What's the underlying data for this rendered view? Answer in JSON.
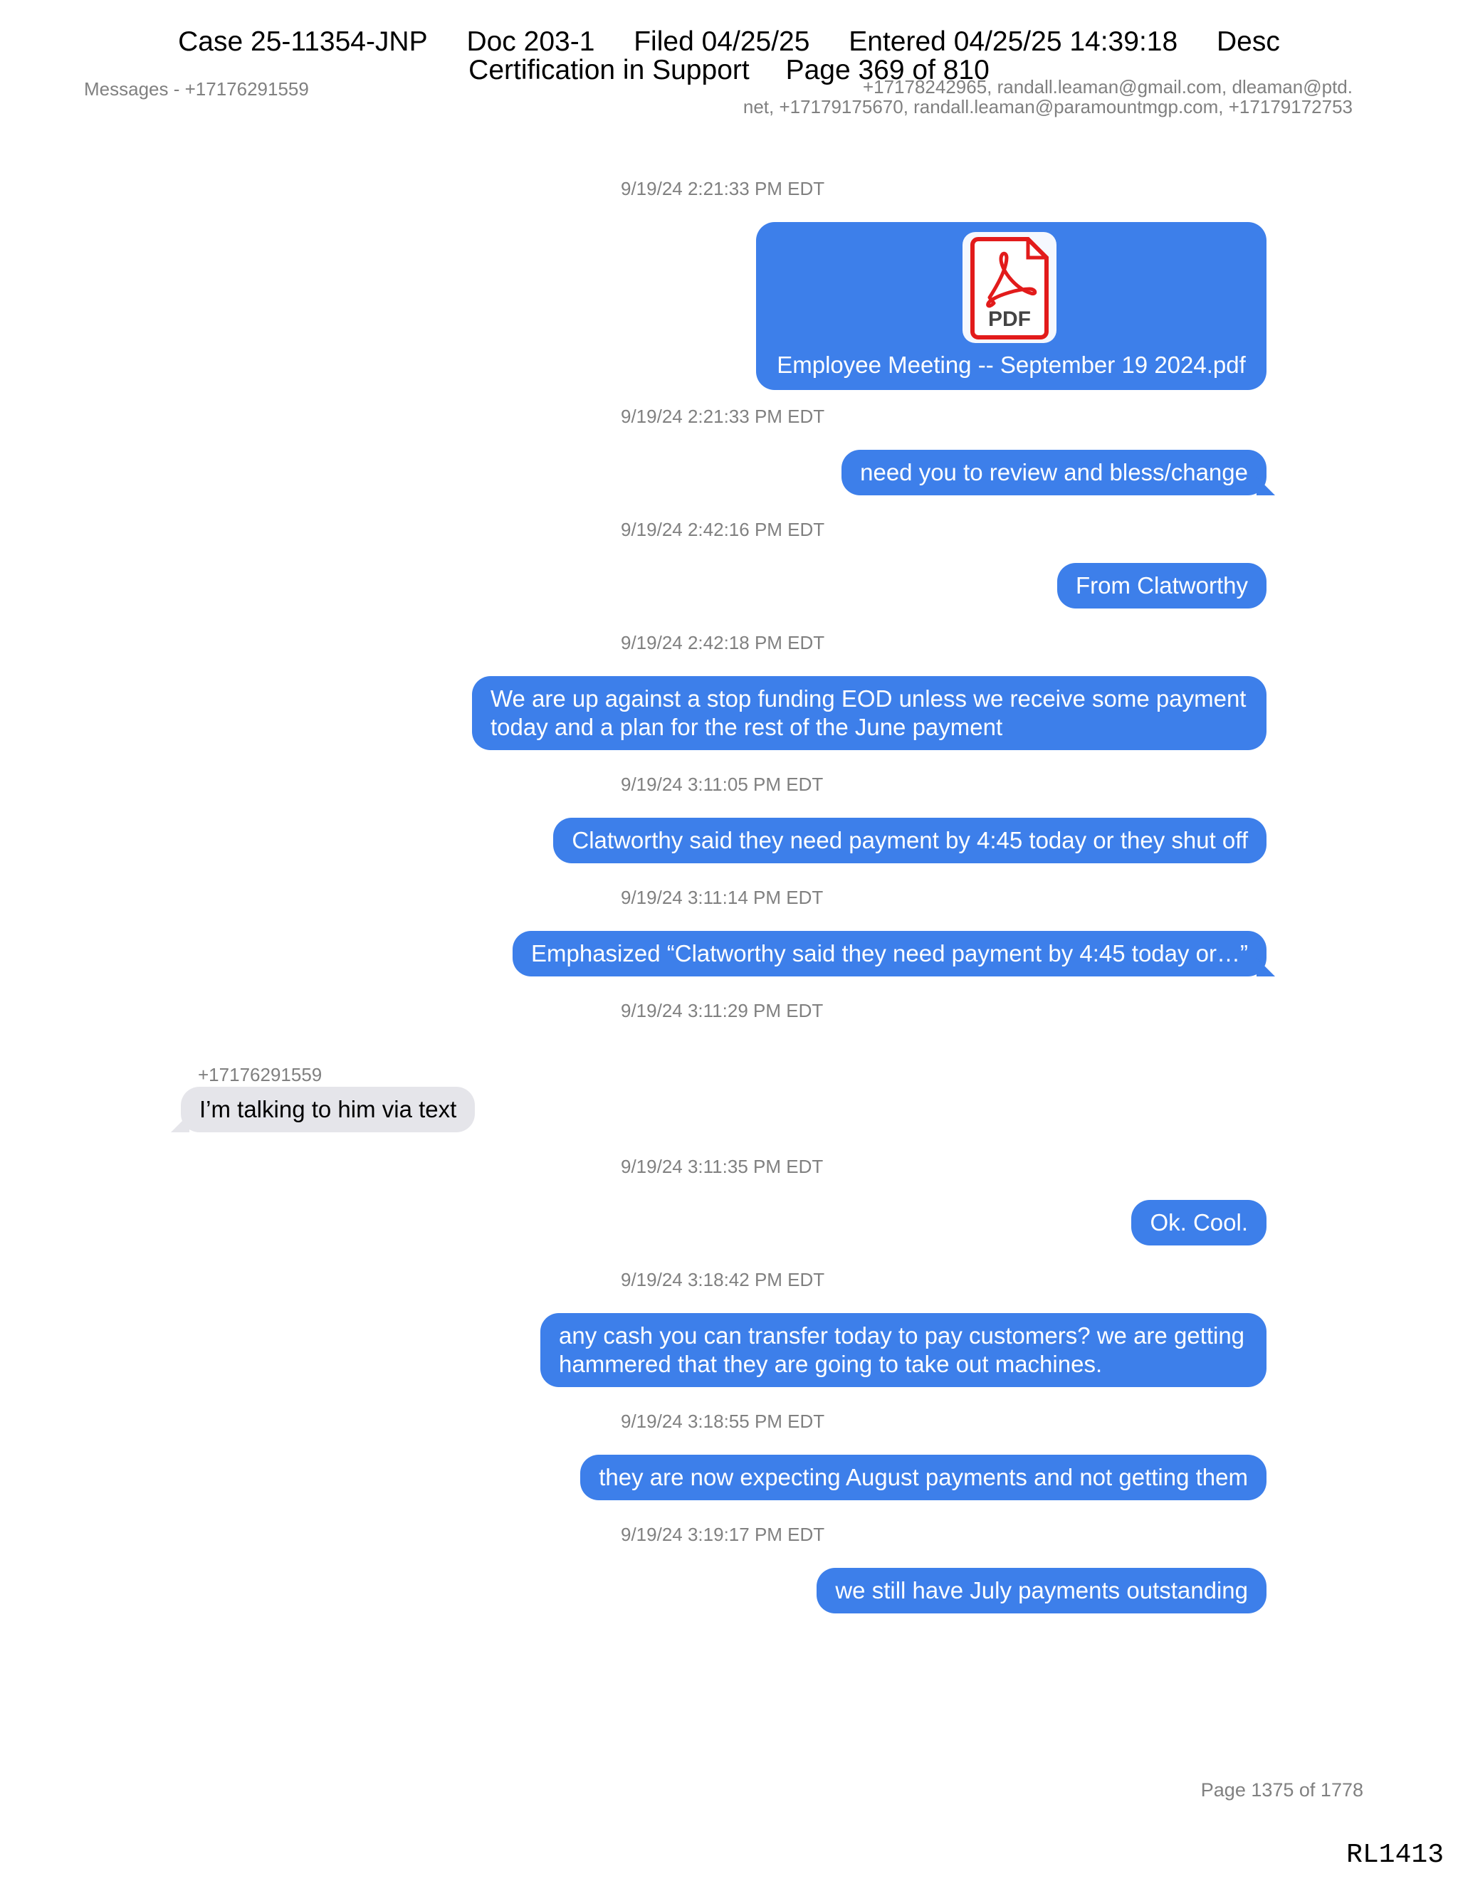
{
  "case_header": {
    "case": "Case 25-11354-JNP",
    "doc": "Doc 203-1",
    "filed": "Filed 04/25/25",
    "entered": "Entered 04/25/25 14:39:18",
    "desc": "Desc",
    "line2": "Certification in Support",
    "page": "Page 369 of 810"
  },
  "thread": {
    "title": "Messages - +17176291559",
    "participants_line1": "+17178242965, randall.leaman@gmail.com, dleaman@ptd.",
    "participants_line2": "net, +17179175670, randall.leaman@paramountmgp.com, +17179172753"
  },
  "messages": [
    {
      "time": "9/19/24 2:21:33 PM EDT",
      "attachment": "Employee Meeting -- September 19 2024.pdf",
      "icon": "pdf-icon"
    },
    {
      "time": "9/19/24 2:21:33 PM EDT",
      "text": "need you to review and bless/change"
    },
    {
      "time": "9/19/24 2:42:16 PM EDT",
      "text": "From Clatworthy"
    },
    {
      "time": "9/19/24 2:42:18 PM EDT",
      "text_line1": "We are up against a stop funding EOD unless we receive some payment",
      "text_line2": "today and a plan for the rest of the June payment"
    },
    {
      "time": "9/19/24 3:11:05 PM EDT",
      "text": "Clatworthy said they need payment by 4:45 today or they shut off"
    },
    {
      "time": "9/19/24 3:11:14 PM EDT",
      "text": "Emphasized “Clatworthy said they need payment by 4:45 today or…”"
    },
    {
      "time": "9/19/24 3:11:29 PM EDT",
      "sender": "+17176291559",
      "text": "I’m talking to him via text"
    },
    {
      "time": "9/19/24 3:11:35 PM EDT",
      "text": "Ok. Cool."
    },
    {
      "time": "9/19/24 3:18:42 PM EDT",
      "text_line1": "any cash you can transfer today to pay customers? we are getting",
      "text_line2": "hammered that they are going to take out machines."
    },
    {
      "time": "9/19/24 3:18:55 PM EDT",
      "text": "they are now expecting August payments and not getting them"
    },
    {
      "time": "9/19/24 3:19:17 PM EDT",
      "text": "we still have July payments outstanding"
    }
  ],
  "pdf_icon_label": "PDF",
  "footer": {
    "page": "Page 1375 of 1778",
    "bates": "RL1413"
  },
  "colors": {
    "outgoing_bubble": "#3d7fea",
    "incoming_bubble": "#e5e5ea",
    "pdf_red": "#e21b1b"
  }
}
